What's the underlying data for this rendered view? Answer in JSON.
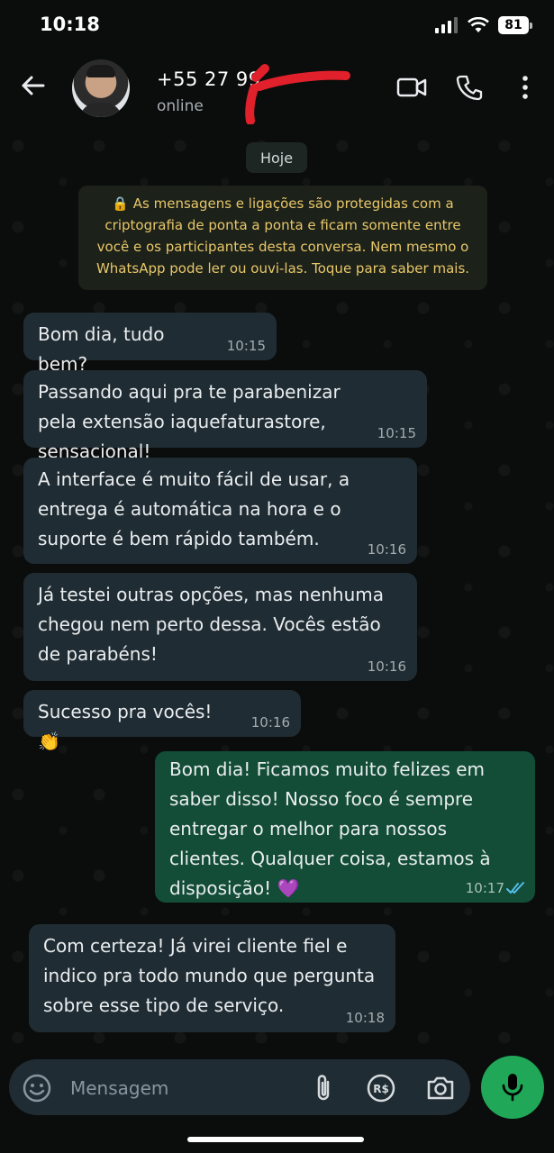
{
  "status_bar": {
    "time": "10:18",
    "battery": "81"
  },
  "header": {
    "contact_name": "+55 27 99",
    "contact_status": "online"
  },
  "chat": {
    "date_label": "Hoje",
    "encryption_notice": "🔒 As mensagens e ligações são protegidas com a criptografia de ponta a ponta e ficam somente entre você e os participantes desta conversa. Nem mesmo o WhatsApp pode ler ou ouvi-las. Toque para saber mais.",
    "messages": [
      {
        "direction": "in",
        "text": "Bom dia, tudo bem?",
        "time": "10:15"
      },
      {
        "direction": "in",
        "text": "Passando aqui pra te parabenizar pela extensão iaquefaturastore, sensacional!",
        "time": "10:15"
      },
      {
        "direction": "in",
        "text": "A interface é muito fácil de usar, a entrega é automática na hora e o suporte é bem rápido também.",
        "time": "10:16"
      },
      {
        "direction": "in",
        "text": "Já testei outras opções, mas nenhuma chegou nem perto dessa. Vocês estão de parabéns!",
        "time": "10:16"
      },
      {
        "direction": "in",
        "text": "Sucesso pra vocês! 👏",
        "time": "10:16"
      },
      {
        "direction": "out",
        "text": "Bom dia! Ficamos muito felizes em saber disso! Nosso foco é sempre entregar o melhor para nossos clientes. Qualquer coisa, estamos à disposição! 💜",
        "time": "10:17",
        "read": true
      },
      {
        "direction": "in",
        "text": "Com certeza! Já virei cliente fiel e indico pra todo mundo que pergunta sobre esse tipo de serviço.",
        "time": "10:18"
      }
    ]
  },
  "composer": {
    "placeholder": "Mensagem"
  },
  "colors": {
    "incoming_bubble": "#202c33",
    "outgoing_bubble": "#134d37",
    "accent": "#20a757",
    "read_ticks": "#53bdeb"
  },
  "icons": [
    "back-arrow-icon",
    "video-call-icon",
    "phone-icon",
    "more-options-icon",
    "emoji-icon",
    "attach-icon",
    "payment-icon",
    "camera-icon",
    "microphone-icon",
    "lock-icon"
  ]
}
